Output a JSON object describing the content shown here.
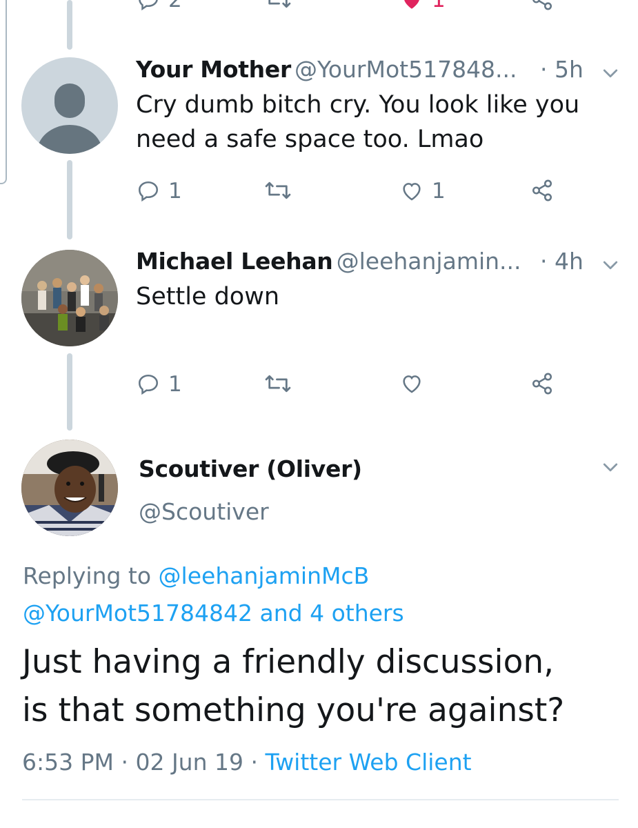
{
  "top_partial": {
    "reply_count": "2",
    "like_count": "1"
  },
  "tweets": [
    {
      "display_name": "Your Mother",
      "handle": "@YourMot517848...",
      "time": "· 5h",
      "text_lines": [
        "Cry dumb bitch cry. You look like you",
        "need a safe space too. Lmao"
      ],
      "reply_count": "1",
      "like_count": "1",
      "avatar": "default-avatar-icon"
    },
    {
      "display_name": "Michael Leehan",
      "handle": "@leehanjamin...",
      "time": "· 4h",
      "text_lines": [
        "Settle down"
      ],
      "reply_count": "1",
      "like_count": "",
      "avatar": "group-photo"
    }
  ],
  "main_tweet": {
    "display_name": "Scoutiver (Oliver)",
    "handle": "@Scoutiver",
    "replying_prefix": "Replying to",
    "replying_user1": "@leehanjaminMcB",
    "replying_user2": "@YourMot51784842",
    "replying_others": "and 4 others",
    "text_lines": [
      "Just having a friendly discussion,",
      "is that something you're against?"
    ],
    "time": "6:53 PM",
    "date": "02 Jun 19",
    "separator": "·",
    "client": "Twitter Web Client"
  },
  "colors": {
    "accent": "#1da1f2",
    "like": "#e0245e",
    "muted": "#657786",
    "thread": "#ccd6dd"
  }
}
